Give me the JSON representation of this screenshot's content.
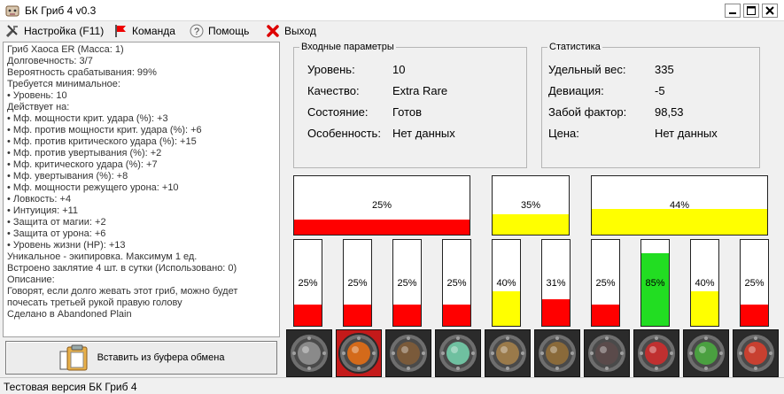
{
  "window": {
    "title": "БК Гриб 4 v0.3"
  },
  "menu": {
    "settings": "Настройка (F11)",
    "team": "Команда",
    "help": "Помощь",
    "exit": "Выход"
  },
  "info_lines": [
    "Гриб Хаоса  ER   (Масса: 1)",
    "Долговечность: 3/7",
    "Вероятность срабатывания: 99%",
    "Требуется минимальное:",
    "• Уровень: 10",
    "Действует на:",
    "• Мф. мощности крит. удара (%): +3",
    "• Мф. против мощности крит. удара (%): +6",
    "• Мф. против критического удара (%): +15",
    "• Мф. против увертывания (%): +2",
    "• Мф. критического удара (%): +7",
    "• Мф. увертывания (%): +8",
    "• Мф. мощности режущего урона: +10",
    "• Ловкость: +4",
    "• Интуиция: +11",
    "• Защита от магии: +2",
    "• Защита от урона: +6",
    "• Уровень жизни (HP): +13",
    "Уникальное - экипировка. Максимум 1 ед.",
    "Встроено заклятие  4 шт. в сутки (Использовано: 0)",
    "Описание:",
    "Говорят, если долго жевать этот гриб, можно будет",
    "почесать третьей рукой правую голову",
    "Сделано в Abandoned Plain"
  ],
  "paste_button": "Вставить из буфера обмена",
  "input_params": {
    "title": "Входные параметры",
    "rows": [
      {
        "label": "Уровень:",
        "value": "10"
      },
      {
        "label": "Качество:",
        "value": "Extra Rare"
      },
      {
        "label": "Состояние:",
        "value": "Готов"
      },
      {
        "label": "Особенность:",
        "value": "Нет данных"
      }
    ]
  },
  "statistics": {
    "title": "Статистика",
    "rows": [
      {
        "label": "Удельный вес:",
        "value": "335"
      },
      {
        "label": "Девиация:",
        "value": "-5"
      },
      {
        "label": "Забой фактор:",
        "value": "98,53"
      },
      {
        "label": "Цена:",
        "value": "Нет данных"
      }
    ]
  },
  "colors": {
    "red": "#ff0000",
    "yellow": "#ffff00",
    "green": "#22dd22"
  },
  "summary_bars": [
    {
      "label": "25%",
      "fill": 0.25,
      "color": "red"
    },
    {
      "label": "35%",
      "fill": 0.35,
      "color": "yellow"
    },
    {
      "label": "44%",
      "fill": 0.44,
      "color": "yellow"
    }
  ],
  "detail_bars": [
    {
      "label": "25%",
      "fill": 0.25,
      "color": "red"
    },
    {
      "label": "25%",
      "fill": 0.25,
      "color": "red"
    },
    {
      "label": "25%",
      "fill": 0.25,
      "color": "red"
    },
    {
      "label": "25%",
      "fill": 0.25,
      "color": "red"
    },
    {
      "label": "40%",
      "fill": 0.4,
      "color": "yellow"
    },
    {
      "label": "31%",
      "fill": 0.31,
      "color": "red"
    },
    {
      "label": "25%",
      "fill": 0.25,
      "color": "red"
    },
    {
      "label": "85%",
      "fill": 0.85,
      "color": "green"
    },
    {
      "label": "40%",
      "fill": 0.4,
      "color": "yellow"
    },
    {
      "label": "25%",
      "fill": 0.25,
      "color": "red"
    }
  ],
  "runes": [
    {
      "icon": "stone-box-rune-icon",
      "tint": "#8a8a8a",
      "selected": false
    },
    {
      "icon": "fire-flower-rune-icon",
      "tint": "#d46a1a",
      "selected": true
    },
    {
      "icon": "tree-stumps-rune-icon",
      "tint": "#7a5a3a",
      "selected": false
    },
    {
      "icon": "lotus-rune-icon",
      "tint": "#6fc0a0",
      "selected": false
    },
    {
      "icon": "sprout-rune-icon",
      "tint": "#9a7a4a",
      "selected": false
    },
    {
      "icon": "broken-fence-rune-icon",
      "tint": "#8a6a3a",
      "selected": false
    },
    {
      "icon": "dark-chest-rune-icon",
      "tint": "#5a4a4a",
      "selected": false
    },
    {
      "icon": "red-dragon-rune-icon",
      "tint": "#c03030",
      "selected": false
    },
    {
      "icon": "green-clover-rune-icon",
      "tint": "#4aa040",
      "selected": false
    },
    {
      "icon": "red-apple-rune-icon",
      "tint": "#c84030",
      "selected": false
    }
  ],
  "status_bar": "Тестовая версия БК Гриб 4"
}
